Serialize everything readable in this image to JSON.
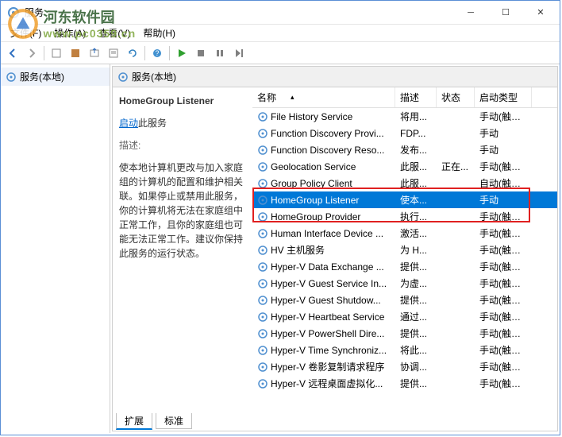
{
  "watermark": {
    "cn": "河东软件园",
    "url": "www.pc0359.cn"
  },
  "window": {
    "title": "服务"
  },
  "menubar": {
    "file": "文件(F)",
    "action": "操作(A)",
    "view": "查看(V)",
    "help": "帮助(H)"
  },
  "left": {
    "label": "服务(本地)"
  },
  "right_header": "服务(本地)",
  "detail": {
    "name": "HomeGroup Listener",
    "start_link": "启动",
    "start_suffix": "此服务",
    "desc_label": "描述:",
    "desc": "使本地计算机更改与加入家庭组的计算机的配置和维护相关联。如果停止或禁用此服务，你的计算机将无法在家庭组中正常工作，且你的家庭组也可能无法正常工作。建议你保持此服务的运行状态。"
  },
  "columns": {
    "name": "名称",
    "desc": "描述",
    "stat": "状态",
    "start": "启动类型"
  },
  "rows": [
    {
      "name": "File History Service",
      "desc": "将用...",
      "stat": "",
      "start": "手动(触发..."
    },
    {
      "name": "Function Discovery Provi...",
      "desc": "FDP...",
      "stat": "",
      "start": "手动"
    },
    {
      "name": "Function Discovery Reso...",
      "desc": "发布...",
      "stat": "",
      "start": "手动"
    },
    {
      "name": "Geolocation Service",
      "desc": "此服...",
      "stat": "正在...",
      "start": "手动(触发..."
    },
    {
      "name": "Group Policy Client",
      "desc": "此服...",
      "stat": "",
      "start": "自动(触发..."
    },
    {
      "name": "HomeGroup Listener",
      "desc": "使本...",
      "stat": "",
      "start": "手动",
      "selected": true
    },
    {
      "name": "HomeGroup Provider",
      "desc": "执行...",
      "stat": "",
      "start": "手动(触发..."
    },
    {
      "name": "Human Interface Device ...",
      "desc": "激活...",
      "stat": "",
      "start": "手动(触发..."
    },
    {
      "name": "HV 主机服务",
      "desc": "为 H...",
      "stat": "",
      "start": "手动(触发..."
    },
    {
      "name": "Hyper-V Data Exchange ...",
      "desc": "提供...",
      "stat": "",
      "start": "手动(触发..."
    },
    {
      "name": "Hyper-V Guest Service In...",
      "desc": "为虚...",
      "stat": "",
      "start": "手动(触发..."
    },
    {
      "name": "Hyper-V Guest Shutdow...",
      "desc": "提供...",
      "stat": "",
      "start": "手动(触发..."
    },
    {
      "name": "Hyper-V Heartbeat Service",
      "desc": "通过...",
      "stat": "",
      "start": "手动(触发..."
    },
    {
      "name": "Hyper-V PowerShell Dire...",
      "desc": "提供...",
      "stat": "",
      "start": "手动(触发..."
    },
    {
      "name": "Hyper-V Time Synchroniz...",
      "desc": "将此...",
      "stat": "",
      "start": "手动(触发..."
    },
    {
      "name": "Hyper-V 卷影复制请求程序",
      "desc": "协调...",
      "stat": "",
      "start": "手动(触发..."
    },
    {
      "name": "Hyper-V 远程桌面虚拟化...",
      "desc": "提供...",
      "stat": "",
      "start": "手动(触发..."
    }
  ],
  "tabs": {
    "ext": "扩展",
    "std": "标准"
  }
}
